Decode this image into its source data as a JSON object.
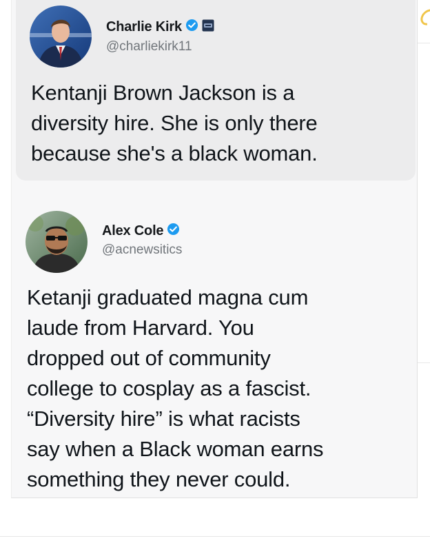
{
  "tweets": [
    {
      "display_name": "Charlie Kirk",
      "handle": "@charliekirk11",
      "verified": true,
      "has_affiliate_badge": true,
      "body_lines": [
        "Kentanji Brown Jackson is a",
        "diversity hire. She is only there",
        "because she's a black woman."
      ]
    },
    {
      "display_name": "Alex Cole",
      "handle": "@acnewsitics",
      "verified": true,
      "has_affiliate_badge": false,
      "body_lines": [
        "Ketanji graduated magna cum",
        "laude from Harvard. You",
        "dropped out of community",
        "college to cosplay as a fascist.",
        "“Diversity hire” is what racists",
        "say when a Black woman earns",
        "something they never could."
      ]
    }
  ],
  "icons": {
    "verified": "verified-badge-icon",
    "affiliate": "affiliate-badge-icon"
  },
  "colors": {
    "verified_blue": "#1d9bf0",
    "text": "#0f1419",
    "handle_gray": "#71767b",
    "quoted_bg": "#ececed",
    "card_bg": "#f7f7f8"
  }
}
